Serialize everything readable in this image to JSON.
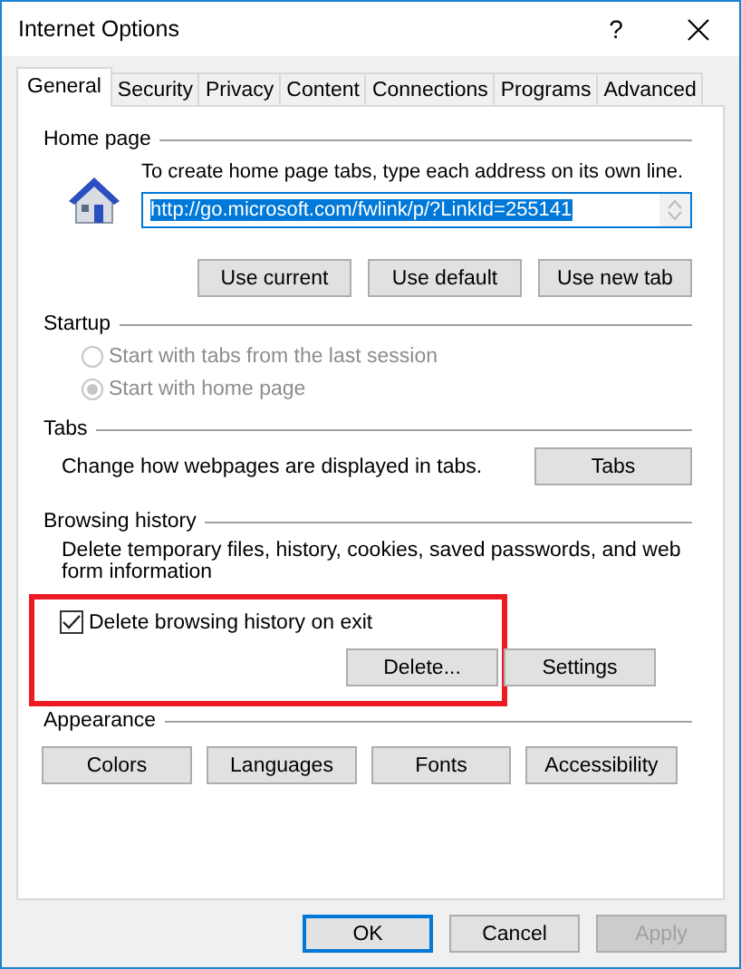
{
  "window": {
    "title": "Internet Options",
    "help": "?"
  },
  "tabs": [
    {
      "label": "General",
      "selected": true
    },
    {
      "label": "Security",
      "selected": false
    },
    {
      "label": "Privacy",
      "selected": false
    },
    {
      "label": "Content",
      "selected": false
    },
    {
      "label": "Connections",
      "selected": false
    },
    {
      "label": "Programs",
      "selected": false
    },
    {
      "label": "Advanced",
      "selected": false
    }
  ],
  "home_page": {
    "heading": "Home page",
    "description": "To create home page tabs, type each address on its own line.",
    "url": "http://go.microsoft.com/fwlink/p/?LinkId=255141",
    "url_selected": true,
    "buttons": [
      "Use current",
      "Use default",
      "Use new tab"
    ]
  },
  "startup": {
    "heading": "Startup",
    "options": [
      {
        "label": "Start with tabs from the last session",
        "selected": false,
        "disabled": true
      },
      {
        "label": "Start with home page",
        "selected": true,
        "disabled": true
      }
    ]
  },
  "tabs_section": {
    "heading": "Tabs",
    "description": "Change how webpages are displayed in tabs.",
    "button": "Tabs"
  },
  "browsing_history": {
    "heading": "Browsing history",
    "description": "Delete temporary files, history, cookies, saved passwords, and web form information",
    "highlighted": true,
    "delete_on_exit": {
      "label": "Delete browsing history on exit",
      "checked": true
    },
    "buttons": [
      "Delete...",
      "Settings"
    ]
  },
  "appearance": {
    "heading": "Appearance",
    "buttons": [
      "Colors",
      "Languages",
      "Fonts",
      "Accessibility"
    ]
  },
  "footer_buttons": [
    {
      "label": "OK",
      "default": true,
      "disabled": false
    },
    {
      "label": "Cancel",
      "default": false,
      "disabled": false
    },
    {
      "label": "Apply",
      "default": false,
      "disabled": true
    }
  ]
}
